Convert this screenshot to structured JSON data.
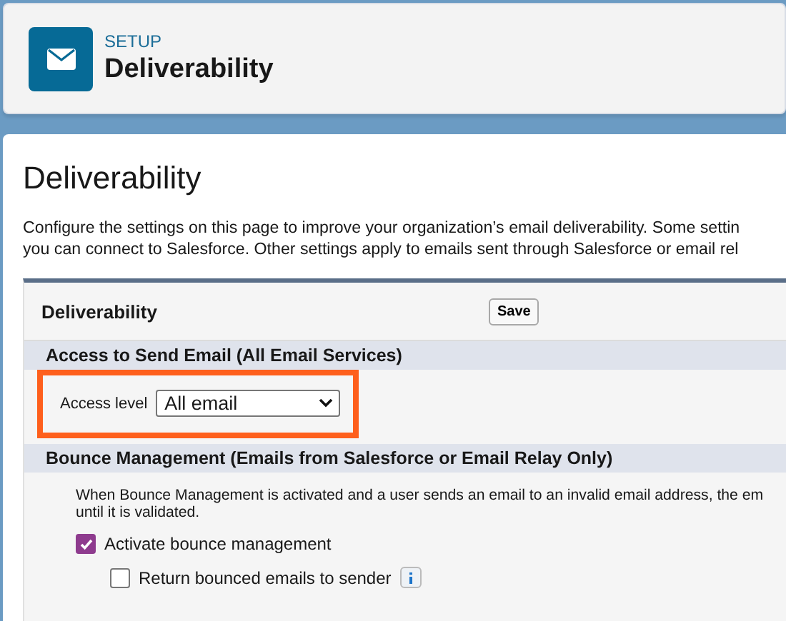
{
  "header": {
    "eyebrow": "SETUP",
    "title": "Deliverability"
  },
  "page": {
    "title": "Deliverability",
    "description": [
      "Configure the settings on this page to improve your organization’s email deliverability. Some settin",
      "you can connect to Salesforce. Other settings apply to emails sent through Salesforce or email rel"
    ]
  },
  "form": {
    "title": "Deliverability",
    "buttons": [
      "Save"
    ],
    "sections": [
      {
        "title": "Access to Send Email (All Email Services)",
        "kind": "select",
        "label": "Access level",
        "value": "All email",
        "highlighted": true
      },
      {
        "title": "Bounce Management (Emails from Salesforce or Email Relay Only)",
        "kind": "options",
        "description": [
          "When Bounce Management is activated and a user sends an email to an invalid email address, the em",
          "until it is validated."
        ],
        "options": [
          {
            "label": "Activate bounce management",
            "checked": true,
            "children": [
              {
                "label": "Return bounced emails to sender",
                "checked": false,
                "info": true
              }
            ]
          }
        ]
      }
    ]
  }
}
